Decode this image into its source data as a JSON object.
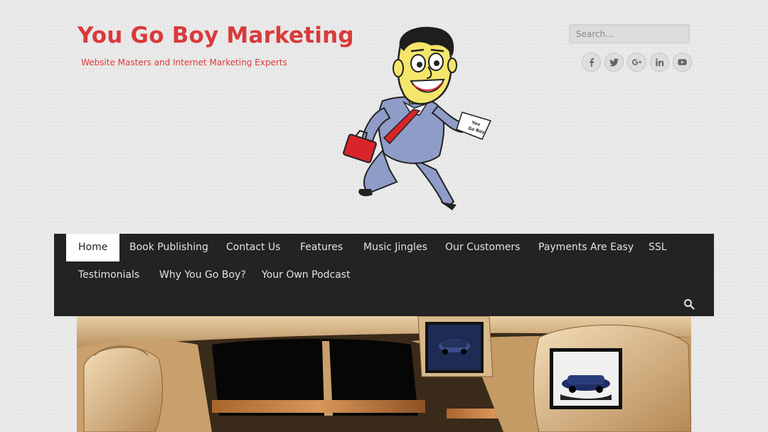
{
  "header": {
    "site_title": "You Go Boy Marketing",
    "tagline": "Website Masters and Internet Marketing Experts",
    "search_placeholder": "Search...",
    "mascot_paper_text": [
      "You",
      "Go Boy!"
    ],
    "brand_color": "#d93a3a"
  },
  "social": [
    {
      "icon": "facebook-icon"
    },
    {
      "icon": "twitter-icon"
    },
    {
      "icon": "google-plus-icon"
    },
    {
      "icon": "linkedin-icon"
    },
    {
      "icon": "youtube-icon"
    }
  ],
  "nav": {
    "items": [
      {
        "label": "Home",
        "active": true
      },
      {
        "label": "Book Publishing"
      },
      {
        "label": "Contact Us"
      },
      {
        "label": "Features"
      },
      {
        "label": "Music Jingles"
      },
      {
        "label": "Our Customers"
      },
      {
        "label": "Payments Are Easy"
      },
      {
        "label": "SSL"
      },
      {
        "label": "Testimonials"
      },
      {
        "label": "Why You Go Boy?"
      },
      {
        "label": "Your Own Podcast"
      }
    ],
    "search_icon": "search-icon",
    "background": "#232323"
  },
  "hero": {
    "image": "luxury-car-interior-with-headrest-screens"
  }
}
